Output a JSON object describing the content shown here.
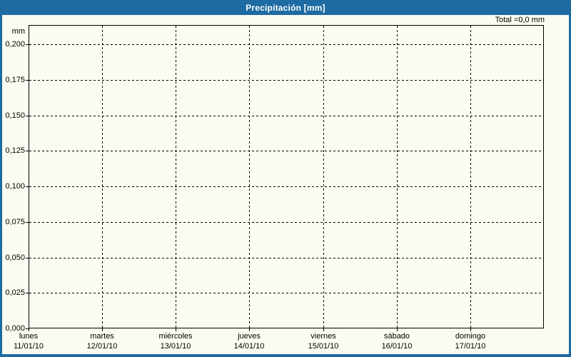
{
  "window_title": "Precipitación [mm]",
  "colors": {
    "accent_blue": "#1e6ba3",
    "background": "#fbfcf1",
    "grid": "#000000",
    "text": "#000000",
    "title_text": "#ffffff"
  },
  "chart_data": {
    "type": "bar",
    "title": "Precipitación [mm]",
    "total_label": "Total =0,0 mm",
    "ylabel": "mm",
    "xlabel": "",
    "categories": [
      "lunes",
      "martes",
      "miércoles",
      "jueves",
      "viernes",
      "sábado",
      "domingo"
    ],
    "category_dates": [
      "11/01/10",
      "12/01/10",
      "13/01/10",
      "14/01/10",
      "15/01/10",
      "16/01/10",
      "17/01/10"
    ],
    "values": [
      0,
      0,
      0,
      0,
      0,
      0,
      0
    ],
    "total_value_mm": 0.0,
    "ytick_labels": [
      "0,000",
      "0,025",
      "0,050",
      "0,075",
      "0,100",
      "0,125",
      "0,150",
      "0,175",
      "0,200"
    ],
    "ytick_values": [
      0,
      0.025,
      0.05,
      0.075,
      0.1,
      0.125,
      0.15,
      0.175,
      0.2
    ],
    "ylim": [
      0,
      0.2136
    ],
    "grid": true,
    "legend": false
  }
}
